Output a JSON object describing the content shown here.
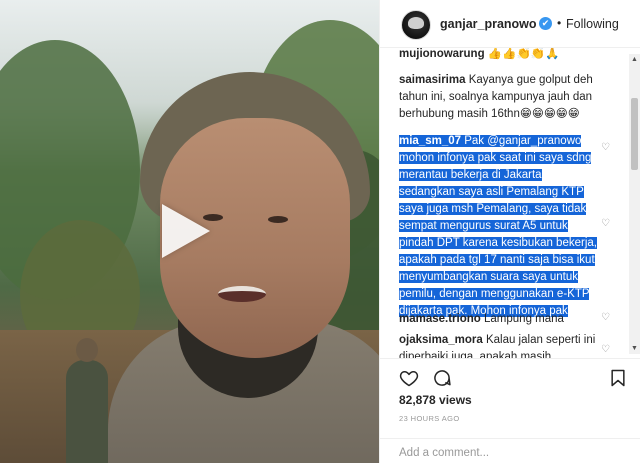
{
  "header": {
    "username": "ganjar_pranowo",
    "verified_mark": "✔",
    "separator": "•",
    "follow_status": "Following"
  },
  "comments": [
    {
      "author": "mujionowarung",
      "text": "👍👍👏👏🙏"
    },
    {
      "author": "saimasirima",
      "text": "Kayanya gue golput deh tahun ini, soalnya kampunya jauh dan berhubung masih 16thn😁😁😁😁😁"
    },
    {
      "author": "mia_sm_07",
      "text": "Pak @ganjar_pranowo mohon infonya pak saat ini saya sdng merantau bekerja di Jakarta sedangkan saya asli Pemalang KTP saya juga msh Pemalang, saya tidak sempat mengurus surat A5 untuk pindah DPT karena kesibukan bekerja, apakah pada tgl 17 nanti saja bisa ikut menyumbangkan suara saya untuk pemilu, dengan menggunakan e-KTP dijakarta pak. Mohon infonya pak"
    },
    {
      "author": "mamase.triono",
      "text": "Lampung mana"
    },
    {
      "author": "ojaksima_mora",
      "text": "Kalau jalan seperti ini diperbaiki juga, apakah masih"
    }
  ],
  "icons": {
    "heart": "heart-icon",
    "comment": "comment-icon",
    "bookmark": "bookmark-icon",
    "play": "play-icon"
  },
  "views": "82,878 views",
  "timestamp": "23 HOURS AGO",
  "add_comment": {
    "placeholder": "Add a comment..."
  },
  "colors": {
    "verified": "#3897f0",
    "selection": "#1565d8",
    "text": "#262626",
    "muted": "#999999"
  }
}
